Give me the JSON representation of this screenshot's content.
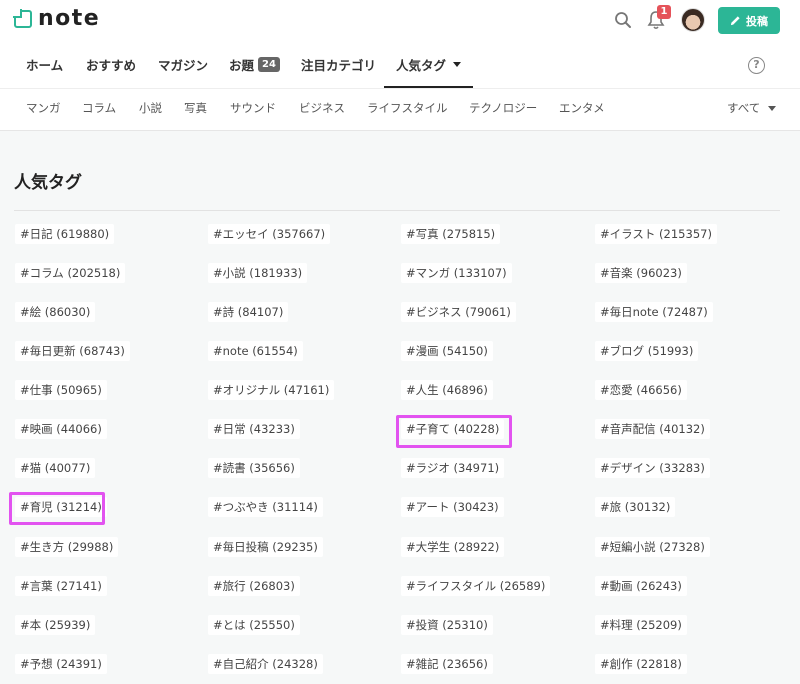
{
  "brand": {
    "logo_text": "note",
    "accent": "#2cb696"
  },
  "header": {
    "notification_count": "1",
    "post_label": "投稿"
  },
  "icons": {
    "search": "search-icon",
    "notifications": "bell-icon",
    "help": "help-icon",
    "post": "pencil-icon"
  },
  "main_nav": {
    "tabs": [
      {
        "label": "ホーム"
      },
      {
        "label": "おすすめ"
      },
      {
        "label": "マガジン"
      },
      {
        "label": "お題",
        "badge": "24"
      },
      {
        "label": "注目カテゴリ"
      },
      {
        "label": "人気タグ",
        "active": true
      }
    ],
    "help": "?"
  },
  "sub_nav": {
    "tabs": [
      "マンガ",
      "コラム",
      "小説",
      "写真",
      "サウンド",
      "ビジネス",
      "ライフスタイル",
      "テクノロジー",
      "エンタメ"
    ],
    "all_label": "すべて"
  },
  "page_title": "人気タグ",
  "highlight_color": "#e253f0",
  "tags": [
    "#日記 (619880)",
    "#エッセイ (357667)",
    "#写真 (275815)",
    "#イラスト (215357)",
    "#コラム (202518)",
    "#小説 (181933)",
    "#マンガ (133107)",
    "#音楽 (96023)",
    "#絵 (86030)",
    "#詩 (84107)",
    "#ビジネス (79061)",
    "#毎日note (72487)",
    "#毎日更新 (68743)",
    "#note (61554)",
    "#漫画 (54150)",
    "#ブログ (51993)",
    "#仕事 (50965)",
    "#オリジナル (47161)",
    "#人生 (46896)",
    "#恋愛 (46656)",
    "#映画 (44066)",
    "#日常 (43233)",
    "#子育て (40228)",
    "#音声配信 (40132)",
    "#猫 (40077)",
    "#読書 (35656)",
    "#ラジオ (34971)",
    "#デザイン (33283)",
    "#育児 (31214)",
    "#つぶやき (31114)",
    "#アート (30423)",
    "#旅 (30132)",
    "#生き方 (29988)",
    "#毎日投稿 (29235)",
    "#大学生 (28922)",
    "#短編小説 (27328)",
    "#言葉 (27141)",
    "#旅行 (26803)",
    "#ライフスタイル (26589)",
    "#動画 (26243)",
    "#本 (25939)",
    "#とは (25550)",
    "#投資 (25310)",
    "#料理 (25209)",
    "#予想 (24391)",
    "#自己紹介 (24328)",
    "#雑記 (23656)",
    "#創作 (22818)"
  ]
}
